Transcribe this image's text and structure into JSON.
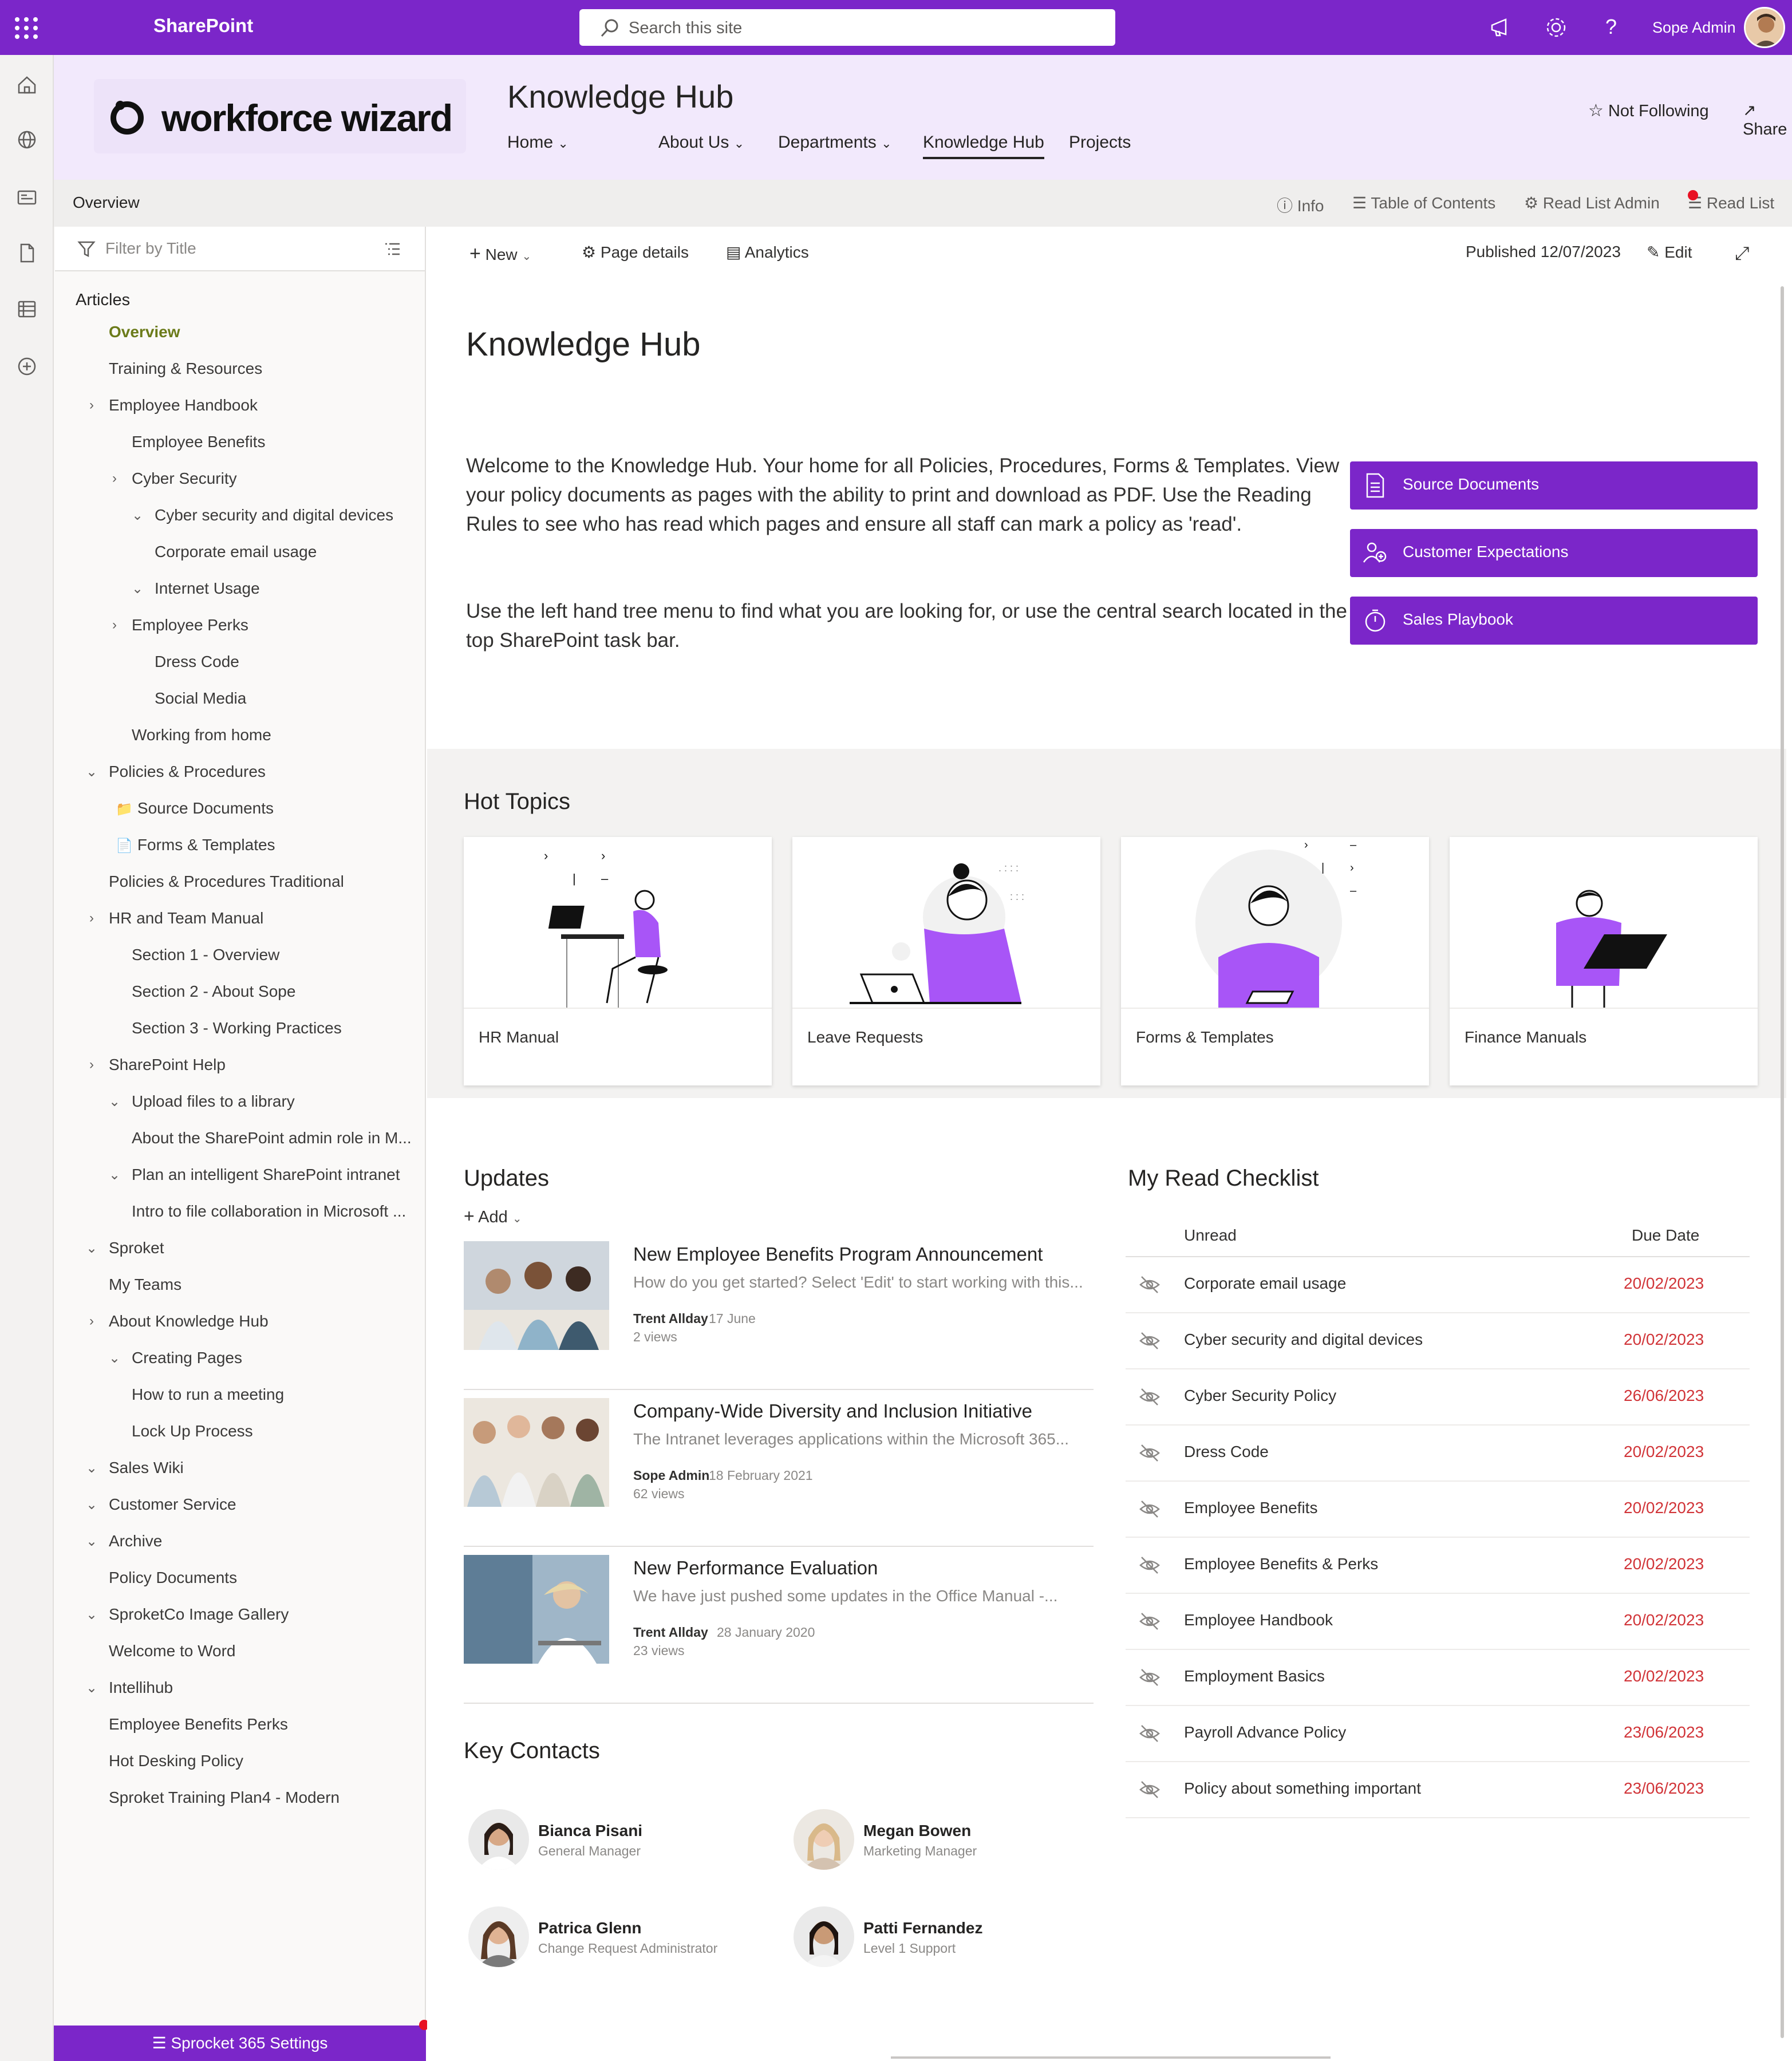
{
  "suite_bar": {
    "app_name": "SharePoint",
    "search_placeholder": "Search this site",
    "user_name": "Sope Admin",
    "accent_color": "#7b26c9"
  },
  "app_bar": {
    "icons": [
      "home-icon",
      "globe-icon",
      "news-icon",
      "document-icon",
      "list-icon",
      "add-icon"
    ]
  },
  "site_header": {
    "logo_text": "workforce wizard",
    "title": "Knowledge Hub",
    "nav": [
      {
        "label": "Home",
        "has_dropdown": true
      },
      {
        "label": "About Us",
        "has_dropdown": true
      },
      {
        "label": "Departments",
        "has_dropdown": true
      },
      {
        "label": "Knowledge Hub",
        "has_dropdown": false,
        "active": true
      },
      {
        "label": "Projects",
        "has_dropdown": false
      }
    ],
    "not_following": "Not Following",
    "share": "Share"
  },
  "command_bar": {
    "overview": "Overview",
    "info": "Info",
    "toc": "Table of Contents",
    "read_list_admin": "Read List Admin",
    "read_list": "Read List"
  },
  "left_nav": {
    "filter_placeholder": "Filter by Title",
    "section_label": "Articles",
    "items": [
      {
        "label": "Overview",
        "level": 1,
        "chevron": "",
        "active": true
      },
      {
        "label": "Training & Resources",
        "level": 1,
        "chevron": ""
      },
      {
        "label": "Employee Handbook",
        "level": 1,
        "chevron": "right"
      },
      {
        "label": "Employee Benefits",
        "level": 2,
        "chevron": ""
      },
      {
        "label": "Cyber Security",
        "level": 2,
        "chevron": "right"
      },
      {
        "label": "Cyber security and digital devices",
        "level": 3,
        "chevron": "down"
      },
      {
        "label": "Corporate email usage",
        "level": 3,
        "chevron": ""
      },
      {
        "label": "Internet Usage",
        "level": 3,
        "chevron": "down"
      },
      {
        "label": "Employee Perks",
        "level": 2,
        "chevron": "right"
      },
      {
        "label": "Dress Code",
        "level": 3,
        "chevron": ""
      },
      {
        "label": "Social Media",
        "level": 3,
        "chevron": ""
      },
      {
        "label": "Working from home",
        "level": 2,
        "chevron": ""
      },
      {
        "label": "Policies & Procedures",
        "level": 1,
        "chevron": "down"
      },
      {
        "label": "Source Documents",
        "level": 1.3,
        "chevron": "",
        "icon": "folder-icon"
      },
      {
        "label": "Forms & Templates",
        "level": 1.3,
        "chevron": "",
        "icon": "page-icon"
      },
      {
        "label": "Policies & Procedures Traditional",
        "level": 1,
        "chevron": ""
      },
      {
        "label": "HR and Team Manual",
        "level": 1,
        "chevron": "right"
      },
      {
        "label": "Section 1 - Overview",
        "level": 2,
        "chevron": ""
      },
      {
        "label": "Section 2 - About Sope",
        "level": 2,
        "chevron": ""
      },
      {
        "label": "Section 3 - Working Practices",
        "level": 2,
        "chevron": ""
      },
      {
        "label": "SharePoint Help",
        "level": 1,
        "chevron": "right"
      },
      {
        "label": "Upload files to a library",
        "level": 2,
        "chevron": "down"
      },
      {
        "label": "About the SharePoint admin role in M...",
        "level": 2,
        "chevron": ""
      },
      {
        "label": "Plan an intelligent SharePoint intranet",
        "level": 2,
        "chevron": "down"
      },
      {
        "label": "Intro to file collaboration in Microsoft ...",
        "level": 2,
        "chevron": ""
      },
      {
        "label": "Sproket",
        "level": 1,
        "chevron": "down"
      },
      {
        "label": "My Teams",
        "level": 1,
        "chevron": ""
      },
      {
        "label": "About Knowledge Hub",
        "level": 1,
        "chevron": "right"
      },
      {
        "label": "Creating Pages",
        "level": 2,
        "chevron": "down"
      },
      {
        "label": "How to run a meeting",
        "level": 2,
        "chevron": ""
      },
      {
        "label": "Lock Up Process",
        "level": 2,
        "chevron": ""
      },
      {
        "label": "Sales Wiki",
        "level": 1,
        "chevron": "down"
      },
      {
        "label": "Customer Service",
        "level": 1,
        "chevron": "down"
      },
      {
        "label": "Archive",
        "level": 1,
        "chevron": "down"
      },
      {
        "label": "Policy Documents",
        "level": 1,
        "chevron": ""
      },
      {
        "label": "SproketCo Image Gallery",
        "level": 1,
        "chevron": "down"
      },
      {
        "label": "Welcome to Word",
        "level": 1,
        "chevron": ""
      },
      {
        "label": "Intellihub",
        "level": 1,
        "chevron": "down"
      },
      {
        "label": "Employee Benefits Perks",
        "level": 1,
        "chevron": ""
      },
      {
        "label": "Hot Desking Policy",
        "level": 1,
        "chevron": ""
      },
      {
        "label": "Sproket Training Plan4 - Modern",
        "level": 1,
        "chevron": ""
      }
    ],
    "settings_button": "Sprocket 365 Settings"
  },
  "page_toolbar": {
    "new": "New",
    "page_details": "Page details",
    "analytics": "Analytics",
    "published": "Published 12/07/2023",
    "edit": "Edit"
  },
  "page": {
    "title": "Knowledge Hub",
    "intro_1": "Welcome to the Knowledge Hub. Your home for all Policies, Procedures, Forms & Templates. View your policy documents as pages with the ability to print and download as PDF. Use the Reading Rules to see who has read which pages and ensure all staff can mark a policy as 'read'.",
    "intro_2": "Use the left hand tree menu to find what you are looking for, or use the central search located in the top SharePoint task bar.",
    "quick_links": [
      "Source Documents",
      "Customer Expectations",
      "Sales Playbook"
    ]
  },
  "hot_topics": {
    "title": "Hot Topics",
    "cards": [
      "HR Manual",
      "Leave Requests",
      "Forms & Templates",
      "Finance Manuals"
    ]
  },
  "updates": {
    "title": "Updates",
    "add": "Add",
    "items": [
      {
        "title": "New Employee Benefits Program Announcement",
        "desc": "How do you get started? Select 'Edit' to start working with this...",
        "author": "Trent Allday",
        "date": "17 June",
        "views": "2 views"
      },
      {
        "title": "Company-Wide Diversity and Inclusion Initiative",
        "desc": "The Intranet leverages applications within the Microsoft 365...",
        "author": "Sope Admin",
        "date": "18 February 2021",
        "views": "62 views"
      },
      {
        "title": "New Performance Evaluation",
        "desc": "We have just pushed some updates in the Office Manual -...",
        "author": "Trent Allday",
        "date": "28 January 2020",
        "views": "23 views"
      }
    ]
  },
  "key_contacts": {
    "title": "Key Contacts",
    "contacts": [
      {
        "name": "Bianca Pisani",
        "role": "General Manager"
      },
      {
        "name": "Megan Bowen",
        "role": "Marketing Manager"
      },
      {
        "name": "Patrica Glenn",
        "role": "Change Request Administrator"
      },
      {
        "name": "Patti Fernandez",
        "role": "Level 1 Support"
      }
    ]
  },
  "read_checklist": {
    "title": "My Read Checklist",
    "col_unread": "Unread",
    "col_due": "Due Date",
    "due_color": "#d13438",
    "rows": [
      {
        "name": "Corporate email usage",
        "due": "20/02/2023"
      },
      {
        "name": "Cyber security and digital devices",
        "due": "20/02/2023"
      },
      {
        "name": "Cyber Security Policy",
        "due": "26/06/2023"
      },
      {
        "name": "Dress Code",
        "due": "20/02/2023"
      },
      {
        "name": "Employee Benefits",
        "due": "20/02/2023"
      },
      {
        "name": "Employee Benefits & Perks",
        "due": "20/02/2023"
      },
      {
        "name": "Employee Handbook",
        "due": "20/02/2023"
      },
      {
        "name": "Employment Basics",
        "due": "20/02/2023"
      },
      {
        "name": "Payroll Advance Policy",
        "due": "23/06/2023"
      },
      {
        "name": "Policy about something important",
        "due": "23/06/2023"
      }
    ]
  }
}
